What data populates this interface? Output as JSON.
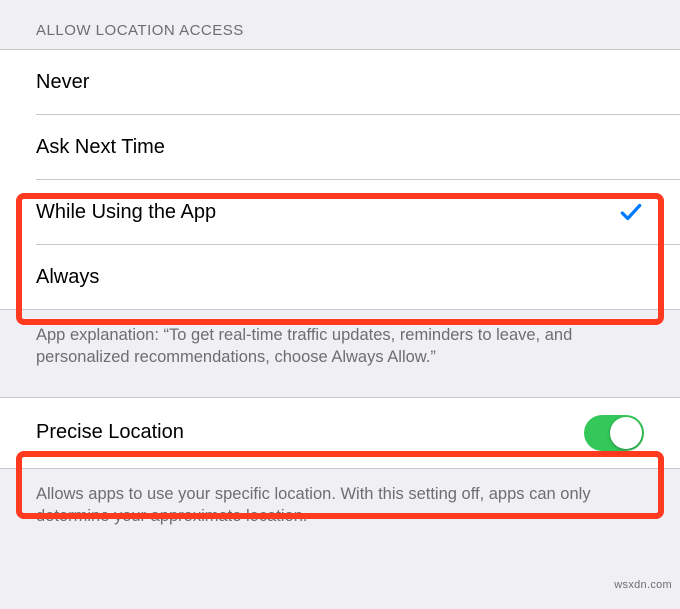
{
  "section_header": "ALLOW LOCATION ACCESS",
  "options": {
    "never": "Never",
    "ask": "Ask Next Time",
    "while": "While Using the App",
    "always": "Always"
  },
  "app_explanation": "App explanation: “To get real-time traffic updates, reminders to leave, and personalized recommendations, choose Always Allow.”",
  "precise": {
    "label": "Precise Location",
    "enabled": true
  },
  "precise_footer": "Allows apps to use your specific location. With this setting off, apps can only determine your approximate location.",
  "watermark": "wsxdn.com"
}
